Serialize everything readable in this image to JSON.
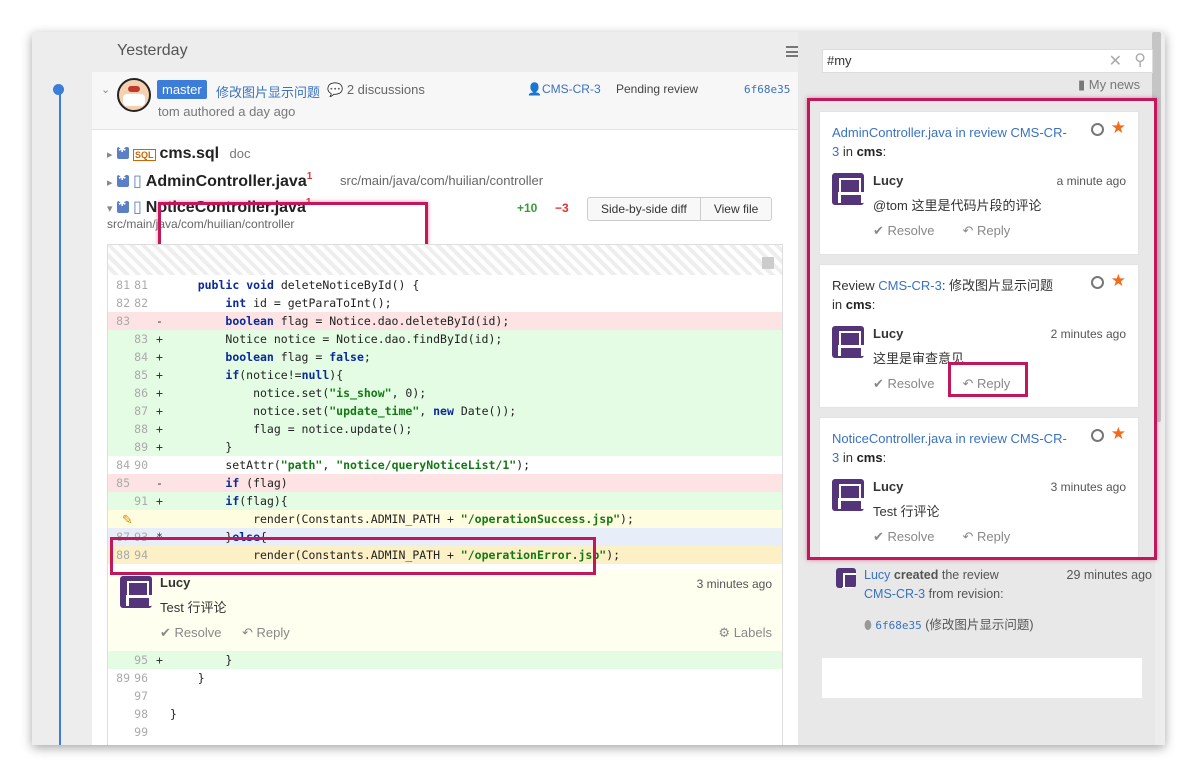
{
  "header": {
    "day": "Yesterday"
  },
  "search": {
    "value": "#my",
    "placeholder": ""
  },
  "my_news": "My news",
  "commit": {
    "branch": "master",
    "message": "修改图片显示问题",
    "discussions": "2 discussions",
    "review": "CMS-CR-3",
    "status": "Pending review",
    "hash": "6f68e35",
    "author": "tom",
    "author_suffix": "authored a day ago"
  },
  "files": [
    {
      "name": "cms.sql",
      "tag": "doc",
      "badge": ""
    },
    {
      "name": "AdminController.java",
      "tag": "",
      "badge": "1",
      "path": "src/main/java/com/huilian/controller"
    },
    {
      "name": "NoticeController.java",
      "tag": "",
      "badge": "1",
      "path": "src/main/java/com/huilian/controller"
    }
  ],
  "diff": {
    "plus": "+10",
    "minus": "−3",
    "btn_side": "Side-by-side diff",
    "btn_view": "View file"
  },
  "code": [
    {
      "n1": "81",
      "n2": "81",
      "s": "",
      "c": "    public void deleteNoticeById() {",
      "t": "ctx"
    },
    {
      "n1": "82",
      "n2": "82",
      "s": "",
      "c": "        int id = getParaToInt();",
      "t": "ctx"
    },
    {
      "n1": "83",
      "n2": "",
      "s": "-",
      "c": "        boolean flag = Notice.dao.deleteById(id);",
      "t": "del"
    },
    {
      "n1": "",
      "n2": "83",
      "s": "+",
      "c": "        Notice notice = Notice.dao.findById(id);",
      "t": "add"
    },
    {
      "n1": "",
      "n2": "84",
      "s": "+",
      "c": "        boolean flag = false;",
      "t": "add"
    },
    {
      "n1": "",
      "n2": "85",
      "s": "+",
      "c": "        if(notice!=null){",
      "t": "add"
    },
    {
      "n1": "",
      "n2": "86",
      "s": "+",
      "c": "            notice.set(\"is_show\", 0);",
      "t": "add"
    },
    {
      "n1": "",
      "n2": "87",
      "s": "+",
      "c": "            notice.set(\"update_time\", new Date());",
      "t": "add"
    },
    {
      "n1": "",
      "n2": "88",
      "s": "+",
      "c": "            flag = notice.update();",
      "t": "add"
    },
    {
      "n1": "",
      "n2": "89",
      "s": "+",
      "c": "        }",
      "t": "add"
    },
    {
      "n1": "84",
      "n2": "90",
      "s": "",
      "c": "        setAttr(\"path\", \"notice/queryNoticeList/1\");",
      "t": "ctx"
    },
    {
      "n1": "85",
      "n2": "",
      "s": "-",
      "c": "        if (flag)",
      "t": "del"
    },
    {
      "n1": "",
      "n2": "91",
      "s": "+",
      "c": "        if(flag){",
      "t": "add"
    },
    {
      "n1": "",
      "n2": "",
      "s": "",
      "c": "            render(Constants.ADMIN_PATH + \"/operationSuccess.jsp\");",
      "t": "edit"
    },
    {
      "n1": "87",
      "n2": "93",
      "s": "*",
      "c": "        }else{",
      "t": "ctx2"
    },
    {
      "n1": "88",
      "n2": "94",
      "s": "",
      "c": "            render(Constants.ADMIN_PATH + \"/operationError.jsp\");",
      "t": "cur"
    }
  ],
  "code_after": [
    {
      "n1": "",
      "n2": "95",
      "s": "+",
      "c": "        }",
      "t": "add"
    },
    {
      "n1": "89",
      "n2": "96",
      "s": "",
      "c": "    }",
      "t": "ctx"
    },
    {
      "n1": "",
      "n2": "97",
      "s": "",
      "c": "",
      "t": "ctx"
    },
    {
      "n1": "",
      "n2": "98",
      "s": "",
      "c": "}",
      "t": "ctx"
    },
    {
      "n1": "",
      "n2": "99",
      "s": "",
      "c": "",
      "t": "ctx"
    }
  ],
  "inline_comment": {
    "user": "Lucy",
    "time": "3 minutes ago",
    "text": "Test 行评论",
    "resolve": "Resolve",
    "reply": "Reply",
    "labels": "Labels"
  },
  "notifications": [
    {
      "title_link": "AdminController.java in review CMS-CR-3",
      "title_in": " in ",
      "title_proj": "cms",
      "user": "Lucy",
      "time": "a minute ago",
      "text": "@tom 这里是代码片段的评论",
      "resolve": "Resolve",
      "reply": "Reply"
    },
    {
      "title_pre": "Review ",
      "title_link": "CMS-CR-3",
      "title_post": ": 修改图片显示问题",
      "title_in": "in ",
      "title_proj": "cms",
      "user": "Lucy",
      "time": "2 minutes ago",
      "text": "这里是审查意见",
      "resolve": "Resolve",
      "reply": "Reply"
    },
    {
      "title_link": "NoticeController.java in review CMS-CR-3",
      "title_in": " in ",
      "title_proj": "cms",
      "user": "Lucy",
      "time": "3 minutes ago",
      "text": "Test 行评论",
      "resolve": "Resolve",
      "reply": "Reply"
    }
  ],
  "created": {
    "user": "Lucy",
    "action": "created",
    "text": "the review",
    "review": "CMS-CR-3",
    "from": "from revision:",
    "time": "29 minutes ago",
    "hash": "6f68e35",
    "msg": "(修改图片显示问题)"
  },
  "colors": {
    "accent": "#3b7dd8",
    "highlight": "#c2185b",
    "star": "#f26b1d"
  }
}
